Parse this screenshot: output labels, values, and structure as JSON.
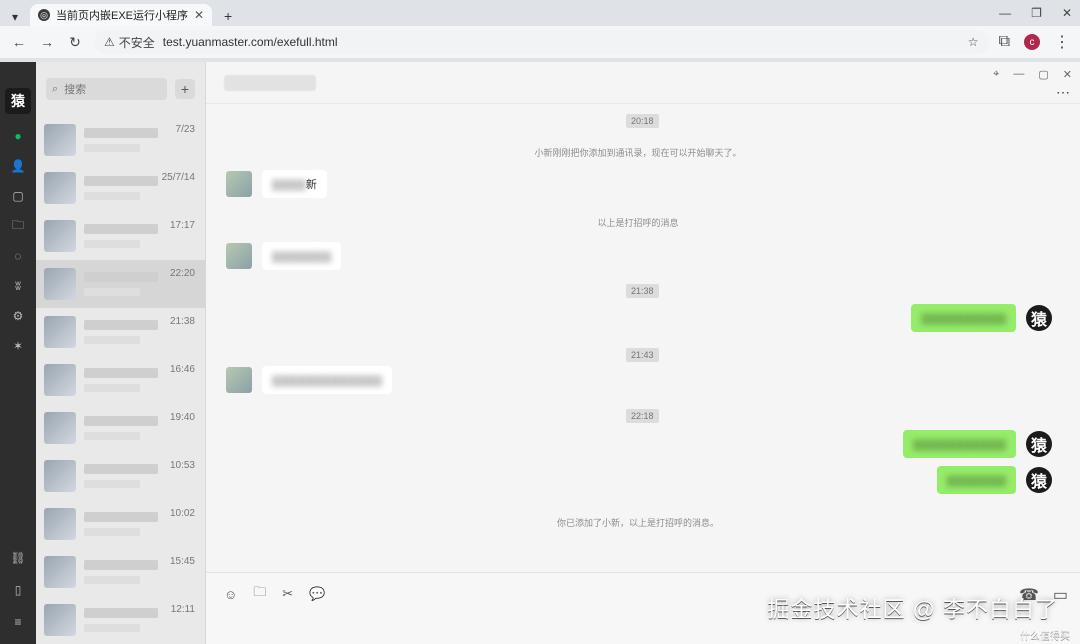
{
  "browser": {
    "tab_title": "当前页内嵌EXE运行小程序",
    "not_secure_label": "不安全",
    "url": "test.yuanmaster.com/exefull.html",
    "profile_initial": "c"
  },
  "sidebar": {
    "avatar_text": "猿"
  },
  "chat_list": {
    "search_placeholder": "搜索",
    "times": [
      "7/23",
      "25/7/14",
      "17:17",
      "22:20",
      "21:38",
      "16:46",
      "19:40",
      "10:53",
      "10:02",
      "15:45",
      "12:11"
    ]
  },
  "chat": {
    "header_title": "",
    "timestamps": [
      "20:18",
      "21:38",
      "21:43",
      "22:18"
    ],
    "system_messages": [
      "小新刚刚把你添加到通讯录，现在可以开始聊天了。",
      "以上是打招呼的消息",
      "你已添加了小新，以上是打招呼的消息。"
    ],
    "messages": {
      "m1": "新",
      "m2": "",
      "m3": "",
      "m4": "",
      "m5": "",
      "m6": ""
    },
    "self_avatar_text": "猿"
  },
  "watermark": {
    "main": "掘金技术社区 @ 李不白白了",
    "sub": "什么值得买"
  },
  "icons": {
    "search": "search-icon",
    "add": "plus-icon",
    "chat": "chat-icon",
    "contacts": "contacts-icon",
    "favorites": "box-icon",
    "files": "folder-icon",
    "moments": "aperture-icon",
    "channels": "butterfly-icon",
    "mini_programs": "gear-icon",
    "settings": "sparkle-icon",
    "link": "link-icon",
    "phone": "phone-icon",
    "menu": "menu-icon",
    "emoji": "emoji-icon",
    "folder": "folder-icon",
    "scissors": "scissors-icon",
    "bubble": "speech-icon",
    "call": "call-icon",
    "video": "video-icon",
    "pin": "pin-icon",
    "minimize": "minimize-icon",
    "maximize": "maximize-icon",
    "close": "close-icon",
    "more": "more-icon"
  }
}
